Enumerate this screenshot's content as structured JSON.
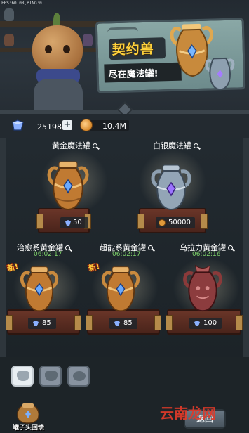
{
  "status": {
    "fps": "FPS:60.08,PING:0"
  },
  "banner": {
    "title": "契约兽",
    "subtitle": "尽在魔法罐!"
  },
  "currency": {
    "gems": "25198",
    "plus": "+",
    "coins": "10.4M"
  },
  "jars": [
    {
      "name": "黄金魔法罐",
      "price": "50",
      "price_type": "gem",
      "timer": "",
      "is_new": false
    },
    {
      "name": "白银魔法罐",
      "price": "50000",
      "price_type": "coin",
      "timer": "",
      "is_new": false
    },
    {
      "name": "治愈系黄金罐",
      "price": "85",
      "price_type": "gem",
      "timer": "06:02:17",
      "is_new": true
    },
    {
      "name": "超能系黄金罐",
      "price": "85",
      "price_type": "gem",
      "timer": "06:02:17",
      "is_new": true
    },
    {
      "name": "乌拉力黄金罐",
      "price": "100",
      "price_type": "gem",
      "timer": "06:02:16",
      "is_new": false
    }
  ],
  "new_label": "新!",
  "bottom": {
    "item_label": "罐子头回馈",
    "back_label": "返回",
    "watermark": "云南龙网"
  },
  "colors": {
    "gold": "#ffd23c",
    "timer_green": "#7fd36b",
    "panel_bg": "#222a30"
  }
}
